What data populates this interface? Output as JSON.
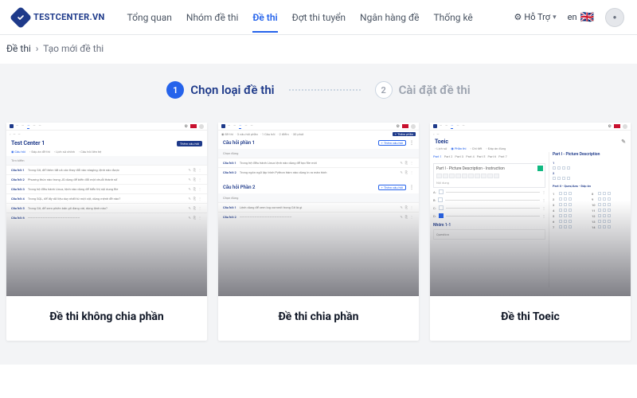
{
  "brand": "TESTCENTER.VN",
  "nav": {
    "items": [
      "Tổng quan",
      "Nhóm đề thi",
      "Đề thi",
      "Đợt thi tuyển",
      "Ngân hàng đề",
      "Thống kê"
    ],
    "active_index": 2
  },
  "header_right": {
    "support_label": "Hỗ Trợ",
    "lang_code": "en"
  },
  "breadcrumb": {
    "root": "Đề thi",
    "current": "Tạo mới đề thi"
  },
  "stepper": {
    "step1": {
      "num": "1",
      "text": "Chọn loại đề thi"
    },
    "step2": {
      "num": "2",
      "text": "Cài đặt đề thi"
    }
  },
  "cards": {
    "c1": {
      "label": "Đề thi không chia phần",
      "preview_title": "Test Center 1"
    },
    "c2": {
      "label": "Đề thi chia phần",
      "preview_sec1": "Câu hỏi phần 1",
      "preview_sec2": "Câu hỏi Phần 2",
      "pill": "+ Thêm câu hỏi"
    },
    "c3": {
      "label": "Đề thi Toeic",
      "preview_title": "Toeic",
      "part_label": "Part I - Picture Description - Instruction",
      "side_label": "Part I - Picture Description",
      "group_label": "Nhóm 1-1"
    }
  },
  "mini": {
    "nav": [
      "Trang chủ",
      "Nhóm đề",
      "Đề thi",
      "Đợt thi tuyển",
      "Ngân hàng",
      "Thống kê"
    ],
    "btn_dark": "Thêm câu hỏi",
    "qlabel": "Câu hỏi",
    "sub_desc": "Chọn đúng"
  }
}
